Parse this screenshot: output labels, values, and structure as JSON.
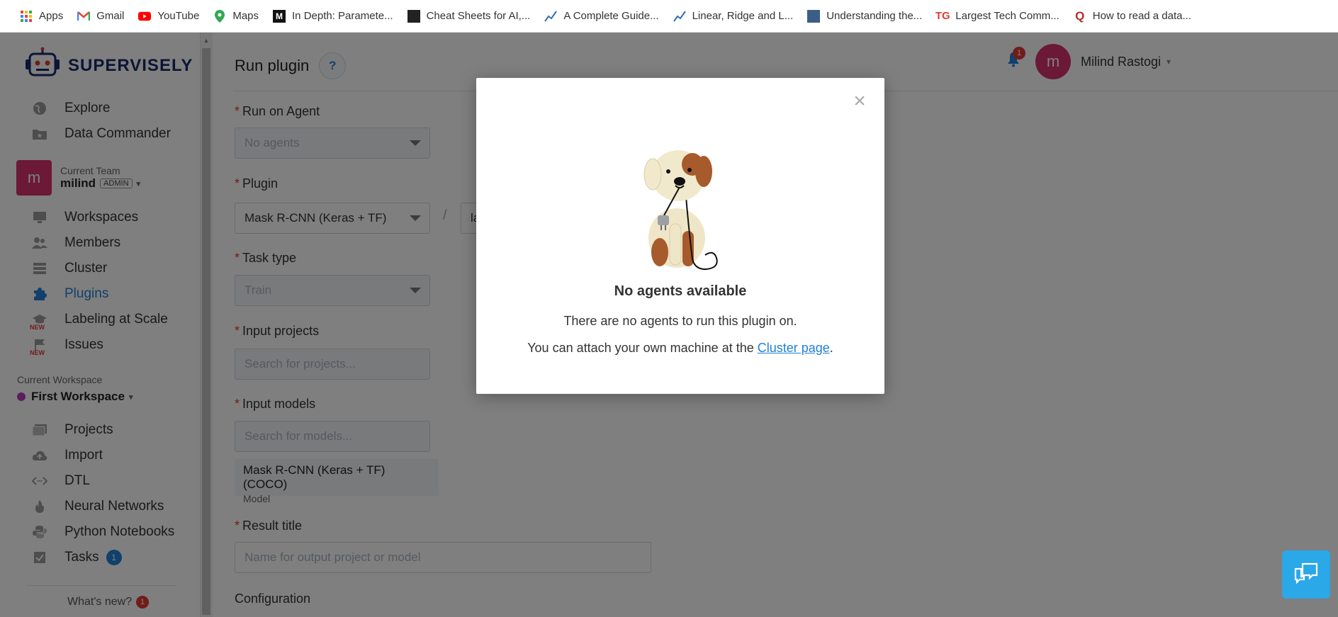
{
  "bookmarks": [
    {
      "label": "Apps",
      "icon": "apps-grid-icon"
    },
    {
      "label": "Gmail",
      "icon": "gmail-icon"
    },
    {
      "label": "YouTube",
      "icon": "youtube-icon"
    },
    {
      "label": "Maps",
      "icon": "maps-icon"
    },
    {
      "label": "In Depth: Paramete...",
      "icon": "medium-icon"
    },
    {
      "label": "Cheat Sheets for AI,...",
      "icon": "cheatsheet-icon"
    },
    {
      "label": "A Complete Guide...",
      "icon": "chart-icon"
    },
    {
      "label": "Linear, Ridge and L...",
      "icon": "chart-icon"
    },
    {
      "label": "Understanding the...",
      "icon": "article-icon"
    },
    {
      "label": "Largest Tech Comm...",
      "icon": "tg-icon"
    },
    {
      "label": "How to read a data...",
      "icon": "quora-icon"
    }
  ],
  "sidebar": {
    "brand": "SUPERVISELY",
    "top_items": [
      {
        "label": "Explore",
        "icon": "globe-icon"
      },
      {
        "label": "Data Commander",
        "icon": "folder-star-icon"
      }
    ],
    "team": {
      "label": "Current Team",
      "name": "milind",
      "role": "ADMIN",
      "avatar": "m"
    },
    "team_items": [
      {
        "label": "Workspaces",
        "icon": "monitor-icon"
      },
      {
        "label": "Members",
        "icon": "users-icon"
      },
      {
        "label": "Cluster",
        "icon": "server-icon"
      },
      {
        "label": "Plugins",
        "icon": "puzzle-icon"
      },
      {
        "label": "Labeling at Scale",
        "icon": "graduation-icon",
        "tag": "NEW"
      },
      {
        "label": "Issues",
        "icon": "flag-icon",
        "tag": "NEW"
      }
    ],
    "workspace": {
      "label": "Current Workspace",
      "name": "First Workspace"
    },
    "workspace_items": [
      {
        "label": "Projects",
        "icon": "images-icon"
      },
      {
        "label": "Import",
        "icon": "cloud-upload-icon"
      },
      {
        "label": "DTL",
        "icon": "code-icon"
      },
      {
        "label": "Neural Networks",
        "icon": "fire-icon"
      },
      {
        "label": "Python Notebooks",
        "icon": "python-icon"
      },
      {
        "label": "Tasks",
        "icon": "checkbox-icon",
        "badge": "1"
      }
    ],
    "whats_new": "What's new?",
    "whats_new_badge": "1"
  },
  "header": {
    "title": "Run plugin",
    "help": "?",
    "notifications_badge": "1",
    "user_avatar": "m",
    "user_name": "Milind Rastogi"
  },
  "form": {
    "agent_label": "Run on Agent",
    "agent_value": "No agents",
    "plugin_label": "Plugin",
    "plugin_value": "Mask R-CNN (Keras + TF)",
    "plugin_separator": "/",
    "version_value": "la",
    "task_label": "Task type",
    "task_value": "Train",
    "projects_label": "Input projects",
    "projects_placeholder": "Search for projects...",
    "models_label": "Input models",
    "models_placeholder": "Search for models...",
    "model_chip_title": "Mask R-CNN (Keras + TF) (COCO)",
    "model_chip_sub": "Model",
    "result_label": "Result title",
    "result_placeholder": "Name for output project or model",
    "config_label": "Configuration",
    "required_mark": "*"
  },
  "modal": {
    "close": "×",
    "title": "No agents available",
    "line1": "There are no agents to run this plugin on.",
    "line2_prefix": "You can attach your own machine at the ",
    "line2_link": "Cluster page",
    "line2_suffix": "."
  },
  "colors": {
    "accent": "#2180d6",
    "danger": "#e53935",
    "avatar": "#d6336c",
    "chat": "#2aa8e8"
  }
}
